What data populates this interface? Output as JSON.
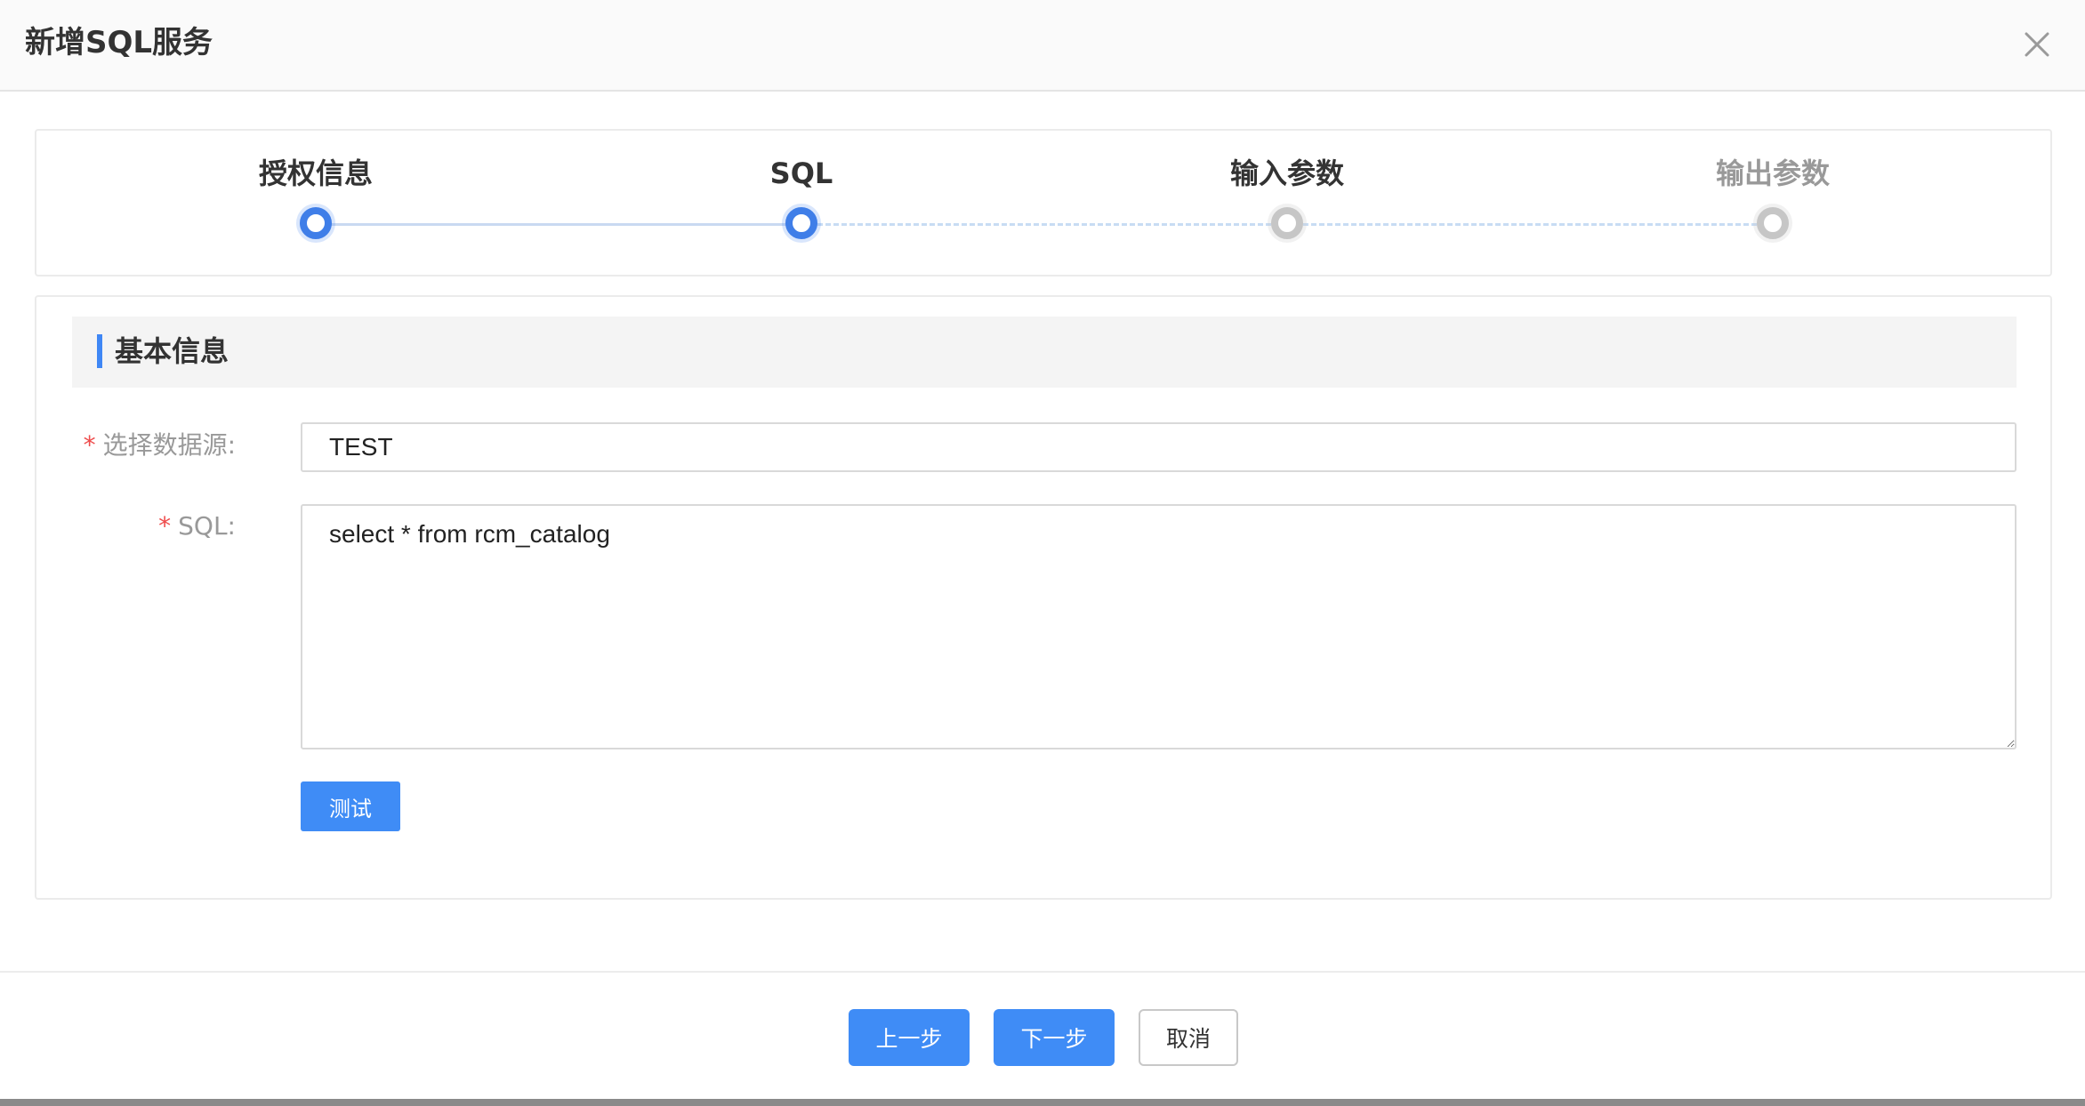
{
  "dialog": {
    "title": "新增SQL服务",
    "close_icon": "close-icon"
  },
  "steps": [
    {
      "label": "授权信息",
      "state": "done"
    },
    {
      "label": "SQL",
      "state": "active"
    },
    {
      "label": "输入参数",
      "state": "todo"
    },
    {
      "label": "输出参数",
      "state": "todo"
    }
  ],
  "section": {
    "title": "基本信息"
  },
  "form": {
    "required_mark": "*",
    "datasource_label": "选择数据源:",
    "datasource_value": "TEST",
    "sql_label": "SQL:",
    "sql_value": "select * from rcm_catalog",
    "test_label": "测试"
  },
  "footer": {
    "prev_label": "上一步",
    "next_label": "下一步",
    "cancel_label": "取消"
  },
  "colors": {
    "primary": "#3f8cf6",
    "required": "#ee4c4c",
    "step_active": "#3f7ee8",
    "step_inactive": "#c6c6c6"
  }
}
